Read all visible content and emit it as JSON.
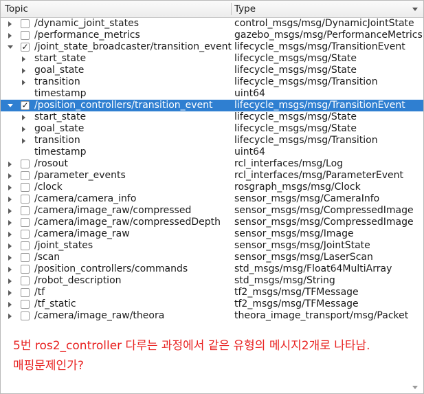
{
  "header": {
    "topic_label": "Topic",
    "type_label": "Type"
  },
  "rows": [
    {
      "depth": 0,
      "expand": "collapsed",
      "check": "",
      "name": "/dynamic_joint_states",
      "type": "control_msgs/msg/DynamicJointState"
    },
    {
      "depth": 0,
      "expand": "collapsed",
      "check": "",
      "name": "/performance_metrics",
      "type": "gazebo_msgs/msg/PerformanceMetrics"
    },
    {
      "depth": 0,
      "expand": "expanded",
      "check": "✓",
      "name": "/joint_state_broadcaster/transition_event",
      "type": "lifecycle_msgs/msg/TransitionEvent"
    },
    {
      "depth": 1,
      "expand": "collapsed",
      "check": null,
      "name": "start_state",
      "type": "lifecycle_msgs/msg/State"
    },
    {
      "depth": 1,
      "expand": "collapsed",
      "check": null,
      "name": "goal_state",
      "type": "lifecycle_msgs/msg/State"
    },
    {
      "depth": 1,
      "expand": "collapsed",
      "check": null,
      "name": "transition",
      "type": "lifecycle_msgs/msg/Transition"
    },
    {
      "depth": 1,
      "expand": "none",
      "check": null,
      "name": "timestamp",
      "type": "uint64"
    },
    {
      "depth": 0,
      "expand": "expanded",
      "check": "✓",
      "name": "/position_controllers/transition_event",
      "type": "lifecycle_msgs/msg/TransitionEvent",
      "selected": true
    },
    {
      "depth": 1,
      "expand": "collapsed",
      "check": null,
      "name": "start_state",
      "type": "lifecycle_msgs/msg/State"
    },
    {
      "depth": 1,
      "expand": "collapsed",
      "check": null,
      "name": "goal_state",
      "type": "lifecycle_msgs/msg/State"
    },
    {
      "depth": 1,
      "expand": "collapsed",
      "check": null,
      "name": "transition",
      "type": "lifecycle_msgs/msg/Transition"
    },
    {
      "depth": 1,
      "expand": "none",
      "check": null,
      "name": "timestamp",
      "type": "uint64"
    },
    {
      "depth": 0,
      "expand": "collapsed",
      "check": "",
      "name": "/rosout",
      "type": "rcl_interfaces/msg/Log"
    },
    {
      "depth": 0,
      "expand": "collapsed",
      "check": "",
      "name": "/parameter_events",
      "type": "rcl_interfaces/msg/ParameterEvent"
    },
    {
      "depth": 0,
      "expand": "collapsed",
      "check": "",
      "name": "/clock",
      "type": "rosgraph_msgs/msg/Clock"
    },
    {
      "depth": 0,
      "expand": "collapsed",
      "check": "",
      "name": "/camera/camera_info",
      "type": "sensor_msgs/msg/CameraInfo"
    },
    {
      "depth": 0,
      "expand": "collapsed",
      "check": "",
      "name": "/camera/image_raw/compressed",
      "type": "sensor_msgs/msg/CompressedImage"
    },
    {
      "depth": 0,
      "expand": "collapsed",
      "check": "",
      "name": "/camera/image_raw/compressedDepth",
      "type": "sensor_msgs/msg/CompressedImage"
    },
    {
      "depth": 0,
      "expand": "collapsed",
      "check": "",
      "name": "/camera/image_raw",
      "type": "sensor_msgs/msg/Image"
    },
    {
      "depth": 0,
      "expand": "collapsed",
      "check": "",
      "name": "/joint_states",
      "type": "sensor_msgs/msg/JointState"
    },
    {
      "depth": 0,
      "expand": "collapsed",
      "check": "",
      "name": "/scan",
      "type": "sensor_msgs/msg/LaserScan"
    },
    {
      "depth": 0,
      "expand": "collapsed",
      "check": "",
      "name": "/position_controllers/commands",
      "type": "std_msgs/msg/Float64MultiArray"
    },
    {
      "depth": 0,
      "expand": "collapsed",
      "check": "",
      "name": "/robot_description",
      "type": "std_msgs/msg/String"
    },
    {
      "depth": 0,
      "expand": "collapsed",
      "check": "",
      "name": "/tf",
      "type": "tf2_msgs/msg/TFMessage"
    },
    {
      "depth": 0,
      "expand": "collapsed",
      "check": "",
      "name": "/tf_static",
      "type": "tf2_msgs/msg/TFMessage"
    },
    {
      "depth": 0,
      "expand": "collapsed",
      "check": "",
      "name": "/camera/image_raw/theora",
      "type": "theora_image_transport/msg/Packet"
    }
  ],
  "annotation": {
    "line1": "5번 ros2_controller 다루는 과정에서 같은 유형의 메시지2개로 나타남.",
    "line2": "매핑문제인가?",
    "color": "#e8201f"
  },
  "colors": {
    "selection": "#2f7fd1"
  }
}
